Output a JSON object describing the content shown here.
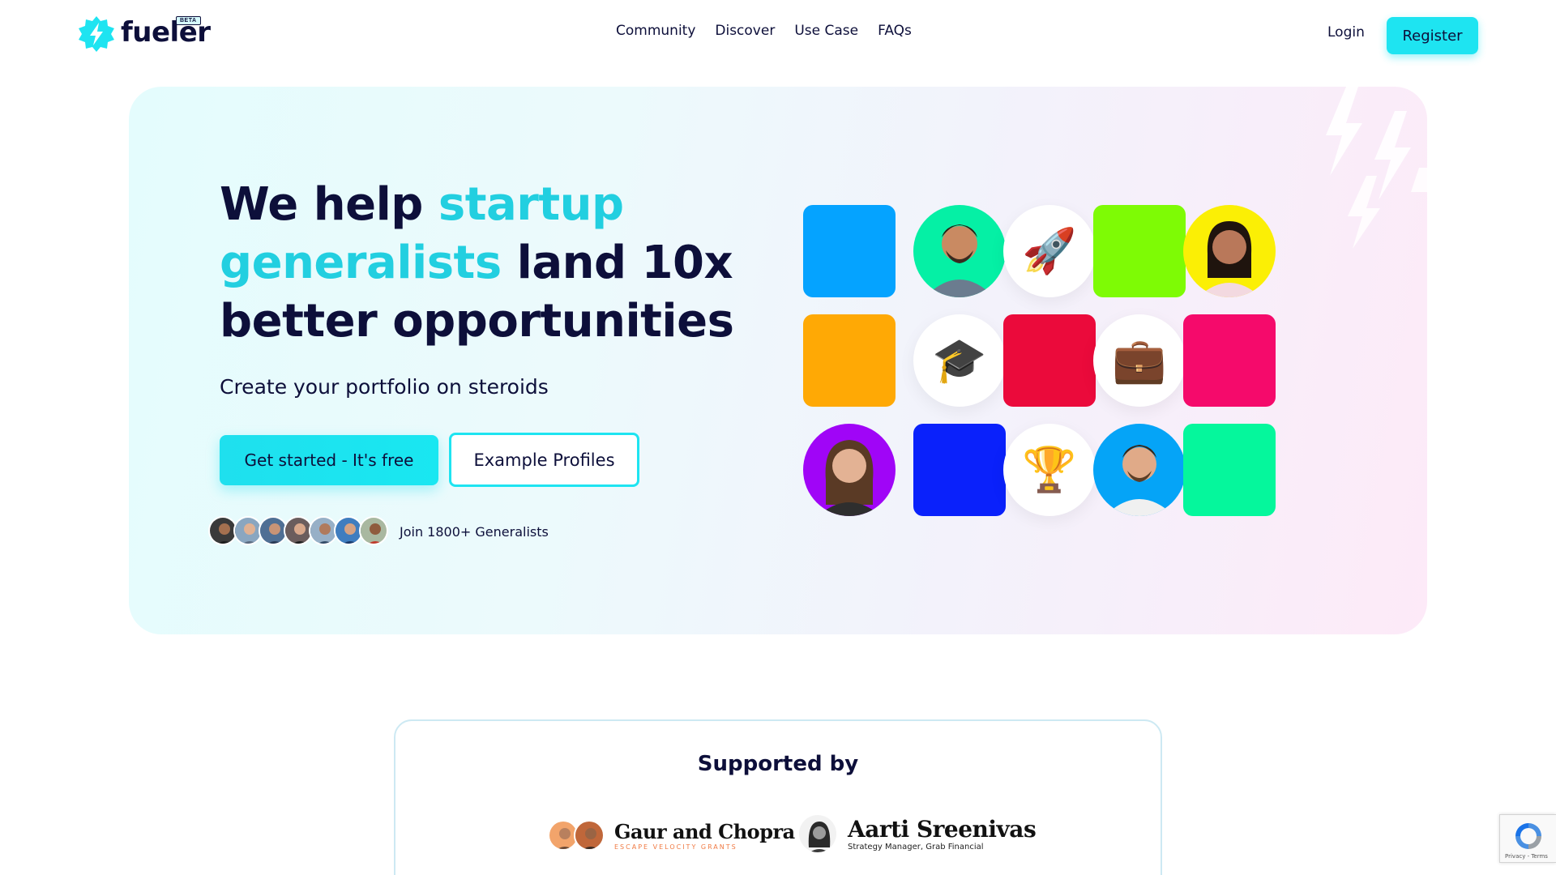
{
  "header": {
    "brand": "fueler",
    "badge": "BETA",
    "nav": [
      "Community",
      "Discover",
      "Use Case",
      "FAQs"
    ],
    "login": "Login",
    "register": "Register"
  },
  "hero": {
    "headline": {
      "part1": "We help ",
      "accent": "startup generalists",
      "part2": " land 10x better opportunities"
    },
    "subtitle": "Create your portfolio on steroids",
    "primary_cta": "Get started - It's free",
    "secondary_cta": "Example Profiles",
    "social_proof": "Join 1800+ Generalists",
    "grid_colors": {
      "blue": "#05a3ff",
      "green_bg": "#05f0a5",
      "lime": "#7efb05",
      "yellow_bg": "#fbef05",
      "orange": "#ffa905",
      "red": "#eb0a3b",
      "pink": "#f50a6b",
      "purple_bg": "#a005f7",
      "royal_blue": "#0a21fb",
      "sky_bg": "#05a4f7",
      "mint": "#05f79c"
    },
    "emojis": {
      "rocket": "🚀",
      "graduation": "🎓",
      "briefcase": "💼",
      "trophy": "🏆"
    }
  },
  "supported": {
    "title": "Supported by",
    "sponsors": [
      {
        "name": "Gaur and Chopra",
        "tag": "ESCAPE VELOCITY GRANTS"
      },
      {
        "name": "Aarti Sreenivas",
        "tag": "Strategy Manager, Grab Financial"
      }
    ]
  },
  "recaptcha": {
    "text": "Privacy - Terms"
  },
  "colors": {
    "accent": "#1ee4f1",
    "dark": "#0d0f3a",
    "accent_text": "#22cfe0"
  }
}
